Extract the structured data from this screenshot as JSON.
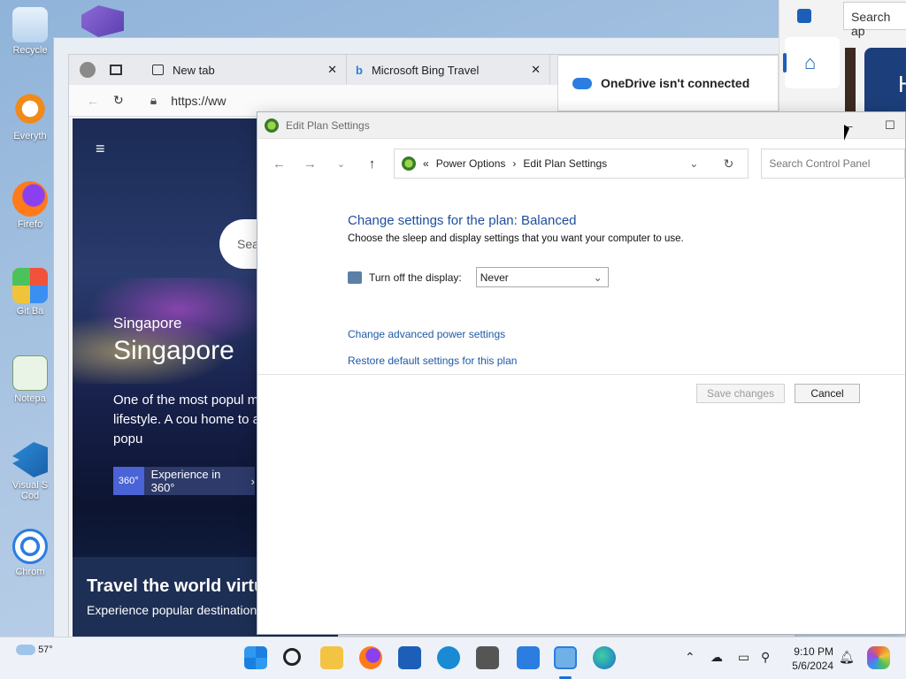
{
  "desktop": {
    "icons": [
      {
        "label": "Recycle"
      },
      {
        "label": "Everyth"
      },
      {
        "label": "Firefo"
      },
      {
        "label": "Git Ba"
      },
      {
        "label": "Notepa"
      },
      {
        "label": "Visual S Cod"
      },
      {
        "label": "Chrom"
      }
    ]
  },
  "browser": {
    "tabs": [
      {
        "label": "New tab"
      },
      {
        "label": "Microsoft Bing Travel"
      }
    ],
    "url": "https://ww",
    "page": {
      "search_placeholder": "Sea",
      "city_small": "Singapore",
      "city_large": "Singapore",
      "description": "One of the most popul modern lifestyle. A cou home to a diverse popu",
      "cta": "Experience in 360°",
      "cta_badge": "360°",
      "bottom_title": "Travel the world virtu",
      "bottom_sub": "Experience popular destination"
    }
  },
  "onedrive": {
    "message": "OneDrive isn't connected"
  },
  "right_panel": {
    "search_placeholder": "Search ap",
    "tile_letter": "H"
  },
  "control_panel": {
    "title": "Edit Plan Settings",
    "breadcrumb": {
      "sep": "«",
      "parent": "Power Options",
      "arrow": "›",
      "current": "Edit Plan Settings"
    },
    "search_placeholder": "Search Control Panel",
    "heading": "Change settings for the plan: Balanced",
    "subheading": "Choose the sleep and display settings that you want your computer to use.",
    "display_label": "Turn off the display:",
    "display_value": "Never",
    "links": {
      "advanced": "Change advanced power settings",
      "restore": "Restore default settings for this plan"
    },
    "buttons": {
      "save": "Save changes",
      "cancel": "Cancel"
    }
  },
  "taskbar": {
    "weather": "57°",
    "time": "9:10 PM",
    "date": "5/6/2024"
  }
}
